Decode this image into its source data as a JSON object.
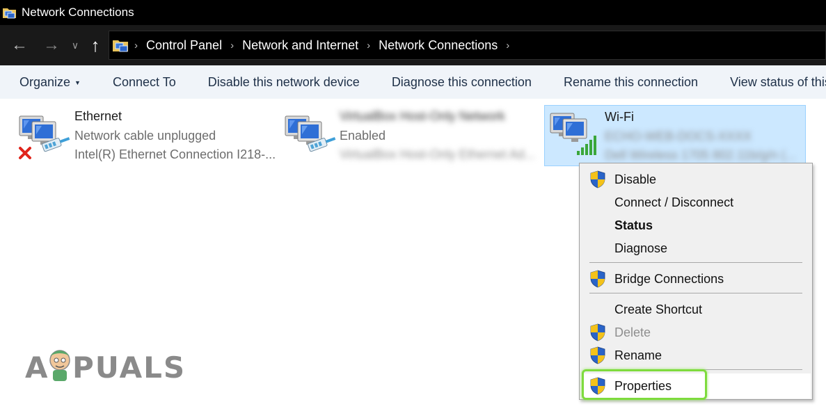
{
  "window": {
    "title": "Network Connections",
    "app_icon": "network-connections-folder-icon"
  },
  "address_bar": {
    "back_icon": "arrow-left-icon",
    "forward_icon": "arrow-right-icon",
    "history_icon": "chevron-down-icon",
    "up_icon": "arrow-up-icon",
    "breadcrumbs": [
      "Control Panel",
      "Network and Internet",
      "Network Connections"
    ],
    "separator": "›"
  },
  "toolbar": {
    "items": [
      "Organize",
      "Connect To",
      "Disable this network device",
      "Diagnose this connection",
      "Rename this connection",
      "View status of this connection"
    ]
  },
  "connections": [
    {
      "name": "Ethernet",
      "status": "Network cable unplugged",
      "device": "Intel(R) Ethernet Connection I218-...",
      "icon": "ethernet-disconnected-icon",
      "blurred": false
    },
    {
      "name": "VirtualBox Host-Only Network",
      "status": "Enabled",
      "device": "VirtualBox Host-Only Ethernet Ad...",
      "icon": "ethernet-adapter-icon",
      "blurred": true
    },
    {
      "name": "Wi-Fi",
      "status": "ECHO-WEB-DOCS-XXXX",
      "device": "Dell Wireless 1705 802.11b/g/n (...",
      "icon": "wifi-adapter-icon",
      "selected": true,
      "blurred": true
    }
  ],
  "context_menu": {
    "items": [
      {
        "label": "Disable",
        "shield": true
      },
      {
        "label": "Connect / Disconnect",
        "shield": false
      },
      {
        "label": "Status",
        "shield": false,
        "bold": true
      },
      {
        "label": "Diagnose",
        "shield": false
      },
      {
        "label": "Bridge Connections",
        "shield": true
      },
      {
        "label": "Create Shortcut",
        "shield": false
      },
      {
        "label": "Delete",
        "shield": true,
        "disabled": true
      },
      {
        "label": "Rename",
        "shield": true
      },
      {
        "label": "Properties",
        "shield": true,
        "highlighted": true
      }
    ]
  },
  "colors": {
    "title_bg": "#000000",
    "address_bg": "#191919",
    "toolbar_bg": "#f0f4f9",
    "selection_bg": "#cce8ff",
    "highlight_outline": "#7edb3d",
    "shield_blue": "#2a64c8",
    "shield_yellow": "#f4c21a"
  },
  "watermark": {
    "text_left": "A",
    "text_right": "PUALS",
    "mascot": "appuals-mascot-icon"
  }
}
